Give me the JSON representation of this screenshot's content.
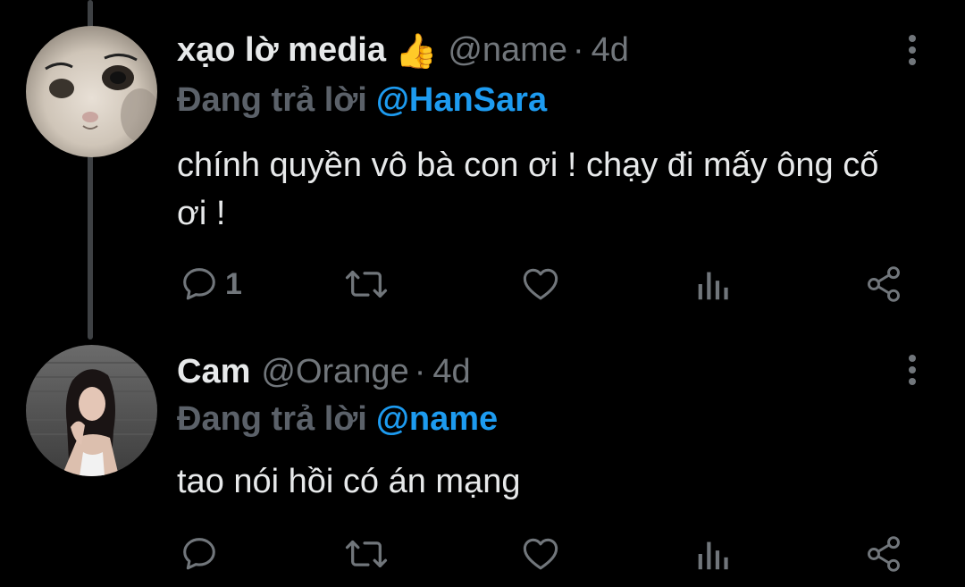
{
  "tweets": [
    {
      "display_name": "xạo lờ media",
      "badge_emoji": "👍",
      "handle": "@name",
      "separator": "·",
      "time": "4d",
      "reply_prefix": "Đang trả lời",
      "reply_to": "@HanSara",
      "text": "chính quyền vô bà con ơi ! chạy đi mấy ông cố ơi !",
      "reply_count": "1",
      "avatar": "cat-face-photo"
    },
    {
      "display_name": "Cam",
      "handle": "@Orange",
      "separator": "·",
      "time": "4d",
      "reply_prefix": "Đang trả lời",
      "reply_to": "@name",
      "text": "tao nói hồi có án mạng",
      "reply_count": "",
      "avatar": "girl-portrait-photo"
    }
  ],
  "icons": {
    "reply": "speech-bubble-icon",
    "retweet": "retweet-arrows-icon",
    "like": "heart-icon",
    "views": "bar-chart-icon",
    "share": "share-nodes-icon",
    "more": "vertical-dots-icon"
  },
  "colors": {
    "background": "#000000",
    "text": "#e7e9ea",
    "muted": "#71767b",
    "link": "#1d9bf0",
    "thread_line": "#3e4144"
  }
}
